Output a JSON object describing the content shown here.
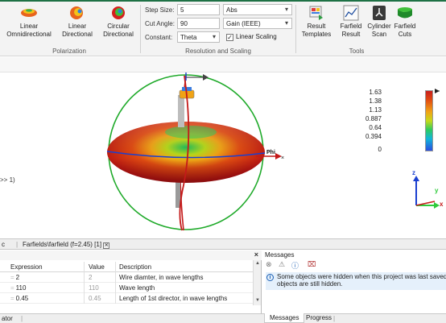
{
  "ribbon": {
    "polarization": {
      "group_label": "Polarization",
      "buttons": [
        {
          "line1": "Linear",
          "line2": "Omnidirectional"
        },
        {
          "line1": "Linear",
          "line2": "Directional"
        },
        {
          "line1": "Circular",
          "line2": "Directional"
        }
      ]
    },
    "resolution": {
      "group_label": "Resolution and Scaling",
      "step_size_label": "Step Size:",
      "step_size_value": "5",
      "cut_angle_label": "Cut Angle:",
      "cut_angle_value": "90",
      "constant_label": "Constant:",
      "constant_value": "Theta",
      "abs_value": "Abs",
      "gain_value": "Gain (IEEE)",
      "linear_scaling_label": "Linear Scaling",
      "linear_scaling_checked": true
    },
    "tools": {
      "group_label": "Tools",
      "buttons": [
        {
          "line1": "Result",
          "line2": "Templates"
        },
        {
          "line1": "Farfield",
          "line2": "Result"
        },
        {
          "line1": "Cylinder",
          "line2": "Scan"
        },
        {
          "line1": "Farfield",
          "line2": "Cuts"
        }
      ]
    }
  },
  "viewport": {
    "left_clip_text": ">> 1)",
    "phi_label": "Phi",
    "axis_z": "z",
    "axis_y": "y",
    "axis_x": "x",
    "color_scale_labels": [
      "1.63",
      "1.38",
      "1.13",
      "0.887",
      "0.64",
      "0.394",
      "0"
    ],
    "colors": {
      "hot": "#d61e1e",
      "mid": "#f0a316",
      "cool": "#2ecb5f",
      "ring": "#1faa2a",
      "cut": "#c41a1a"
    }
  },
  "tabs": {
    "left_clip": "c",
    "active_tab": "Farfields\\farfield (f=2.45) [1]"
  },
  "params": {
    "headers": [
      "Expression",
      "Value",
      "Description"
    ],
    "rows": [
      {
        "expr": "2",
        "value": "2",
        "desc": "Wire diamter, in wave lengths"
      },
      {
        "expr": "110",
        "value": "110",
        "desc": "Wave length"
      },
      {
        "expr": "0.45",
        "value": "0.45",
        "desc": "Length of 1st director, in wave lengths"
      }
    ],
    "bottom_clip": "ator"
  },
  "messages": {
    "title": "Messages",
    "text_line1": "Some objects were hidden when this project was last saved. These",
    "text_line2": "objects are still hidden.",
    "tabs": [
      "Messages",
      "Progress"
    ]
  }
}
